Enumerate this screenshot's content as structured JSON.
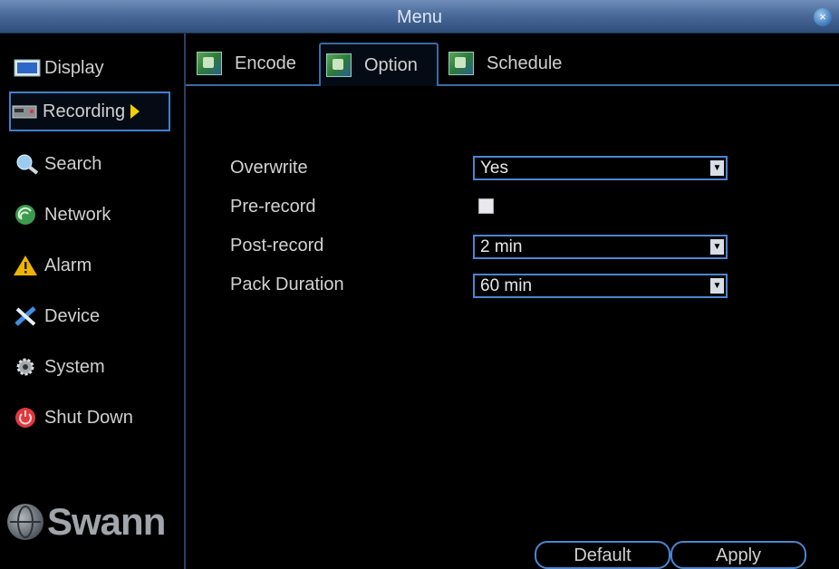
{
  "window": {
    "title": "Menu",
    "close_glyph": "×"
  },
  "sidebar": {
    "items": [
      {
        "label": "Display",
        "icon": "monitor-icon"
      },
      {
        "label": "Recording",
        "icon": "recorder-icon",
        "active": true
      },
      {
        "label": "Search",
        "icon": "search-icon"
      },
      {
        "label": "Network",
        "icon": "network-icon"
      },
      {
        "label": "Alarm",
        "icon": "alarm-icon"
      },
      {
        "label": "Device",
        "icon": "tools-icon"
      },
      {
        "label": "System",
        "icon": "gear-icon"
      },
      {
        "label": "Shut Down",
        "icon": "power-icon"
      }
    ],
    "logo_text": "Swann"
  },
  "tabs": [
    {
      "label": "Encode"
    },
    {
      "label": "Option",
      "active": true
    },
    {
      "label": "Schedule"
    }
  ],
  "form": {
    "overwrite": {
      "label": "Overwrite",
      "value": "Yes"
    },
    "prerecord": {
      "label": "Pre-record",
      "checked": false
    },
    "postrecord": {
      "label": "Post-record",
      "value": "2 min"
    },
    "pack_duration": {
      "label": "Pack Duration",
      "value": "60 min"
    }
  },
  "buttons": {
    "default_label": "Default",
    "apply_label": "Apply"
  },
  "colors": {
    "accent": "#4a86d0",
    "titlebar": "#4a6a9a",
    "arrow": "#f0d000"
  }
}
